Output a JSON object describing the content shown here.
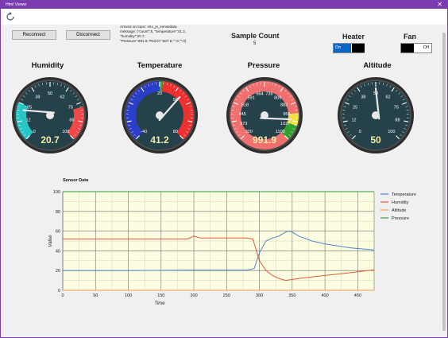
{
  "window": {
    "title": "Html Viewer",
    "close_glyph": "✕"
  },
  "toolbar": {
    "refresh_icon": "refresh-icon"
  },
  "buttons": {
    "reconnect": "Reconnect",
    "disconnect": "Disconnect"
  },
  "message": {
    "line1": "Arrived on topic: mtx_js_sensedata",
    "line2": "message: {\"count\":5, \"temperature\":41.2,",
    "line3": "\"humidity\":20.7,",
    "line4": "\"Pressure\":991.9,\"PiriCO\":587.6,\"\":0,\"\":0}"
  },
  "sample_count": {
    "label": "Sample Count",
    "value": "5"
  },
  "heater": {
    "label": "Heater",
    "state_text": "On"
  },
  "fan": {
    "label": "Fan",
    "state_text": "Off"
  },
  "gauges": [
    {
      "name": "Humidity",
      "value": "20.7",
      "min": 0,
      "max": 100,
      "reading": 20.7,
      "ticks": [
        "0",
        "12",
        "25",
        "38",
        "50",
        "62",
        "75",
        "88",
        "100"
      ]
    },
    {
      "name": "Temperature",
      "value": "41.2",
      "min": -40,
      "max": 80,
      "reading": 41.2,
      "ticks": [
        "-40",
        "",
        "",
        "20",
        "50",
        "",
        "80"
      ]
    },
    {
      "name": "Pressure",
      "value": "991.9",
      "min": 300,
      "max": 1100,
      "reading": 991.9,
      "ticks": [
        "300",
        "373",
        "445",
        "518",
        "591",
        "664",
        "736",
        "809",
        "882",
        "955",
        "1027",
        "1100"
      ]
    },
    {
      "name": "Altitude",
      "value": "50",
      "min": 0,
      "max": 100,
      "reading": 50,
      "ticks": [
        "0",
        "12",
        "25",
        "38",
        "50",
        "62",
        "75",
        "88",
        "100"
      ]
    }
  ],
  "chart_data": {
    "type": "line",
    "title": "Sensor Data",
    "xlabel": "Time",
    "ylabel": "Value",
    "xlim": [
      0,
      475
    ],
    "ylim": [
      0,
      100
    ],
    "xticks": [
      0,
      50,
      100,
      150,
      200,
      250,
      300,
      350,
      400,
      450
    ],
    "yticks": [
      0,
      20,
      40,
      60,
      80,
      100
    ],
    "grid": true,
    "legend_position": "right",
    "series": [
      {
        "name": "Temperature",
        "color": "#4a86c8",
        "x": [
          0,
          100,
          200,
          280,
          292,
          300,
          310,
          320,
          330,
          340,
          345,
          350,
          360,
          380,
          400,
          440,
          475
        ],
        "y": [
          20,
          20,
          20.5,
          20.5,
          22,
          38,
          50,
          53,
          55,
          59,
          60,
          59,
          55,
          50,
          47,
          43,
          41
        ]
      },
      {
        "name": "Humidity",
        "color": "#e05a3a",
        "x": [
          0,
          100,
          190,
          200,
          210,
          280,
          290,
          300,
          310,
          320,
          330,
          340,
          350,
          360,
          400,
          440,
          475
        ],
        "y": [
          52,
          52,
          52,
          55,
          53,
          53,
          52,
          30,
          20,
          15,
          12,
          10,
          11,
          12,
          15,
          18,
          20.7
        ]
      },
      {
        "name": "Altitude",
        "color": "#f0a050",
        "x": [
          0,
          475
        ],
        "y": [
          0,
          0
        ]
      },
      {
        "name": "Pressure",
        "color": "#3a9a3a",
        "x": [
          0,
          475
        ],
        "y": [
          100,
          100
        ]
      }
    ]
  }
}
